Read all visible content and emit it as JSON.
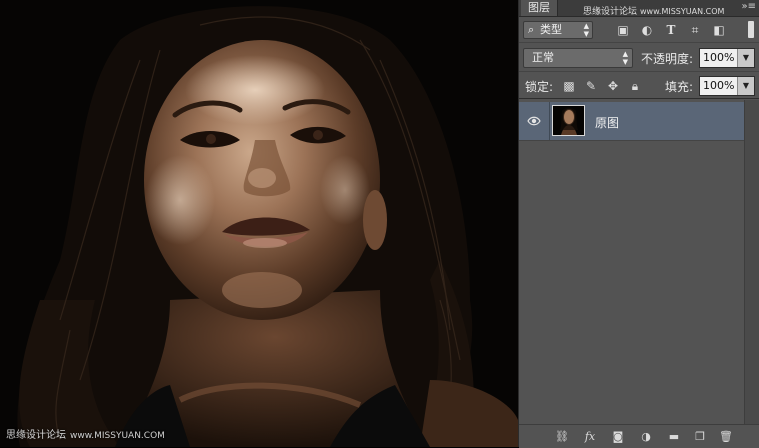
{
  "canvas": {
    "watermark_text": "思缘设计论坛",
    "watermark_site": "www.MISSYUAN.COM"
  },
  "panel": {
    "tab_label": "图层",
    "watermark_text": "思缘设计论坛",
    "watermark_site": "www.MISSYUAN.COM",
    "menu_icon": "panel-menu-icon",
    "filter": {
      "label": "类型",
      "icons": [
        "image-filter-icon",
        "adjustment-filter-icon",
        "type-filter-icon",
        "shape-filter-icon",
        "smart-object-filter-icon"
      ]
    },
    "blend": {
      "mode": "正常",
      "opacity_label": "不透明度:",
      "opacity_value": "100%"
    },
    "lock": {
      "label": "锁定:",
      "icons": [
        "lock-transparent-icon",
        "lock-paint-icon",
        "lock-position-icon",
        "lock-all-icon"
      ],
      "fill_label": "填充:",
      "fill_value": "100%"
    },
    "layers": [
      {
        "name": "原图",
        "visible": true,
        "selected": true
      }
    ],
    "bottom_icons": [
      "link-layers-icon",
      "layer-style-icon",
      "add-mask-icon",
      "new-adjustment-icon",
      "new-group-icon",
      "new-layer-icon",
      "delete-layer-icon"
    ],
    "colors": {
      "panel_bg": "#535353",
      "selected_row": "#5a6677",
      "tab_bar": "#3c3c3c"
    }
  }
}
